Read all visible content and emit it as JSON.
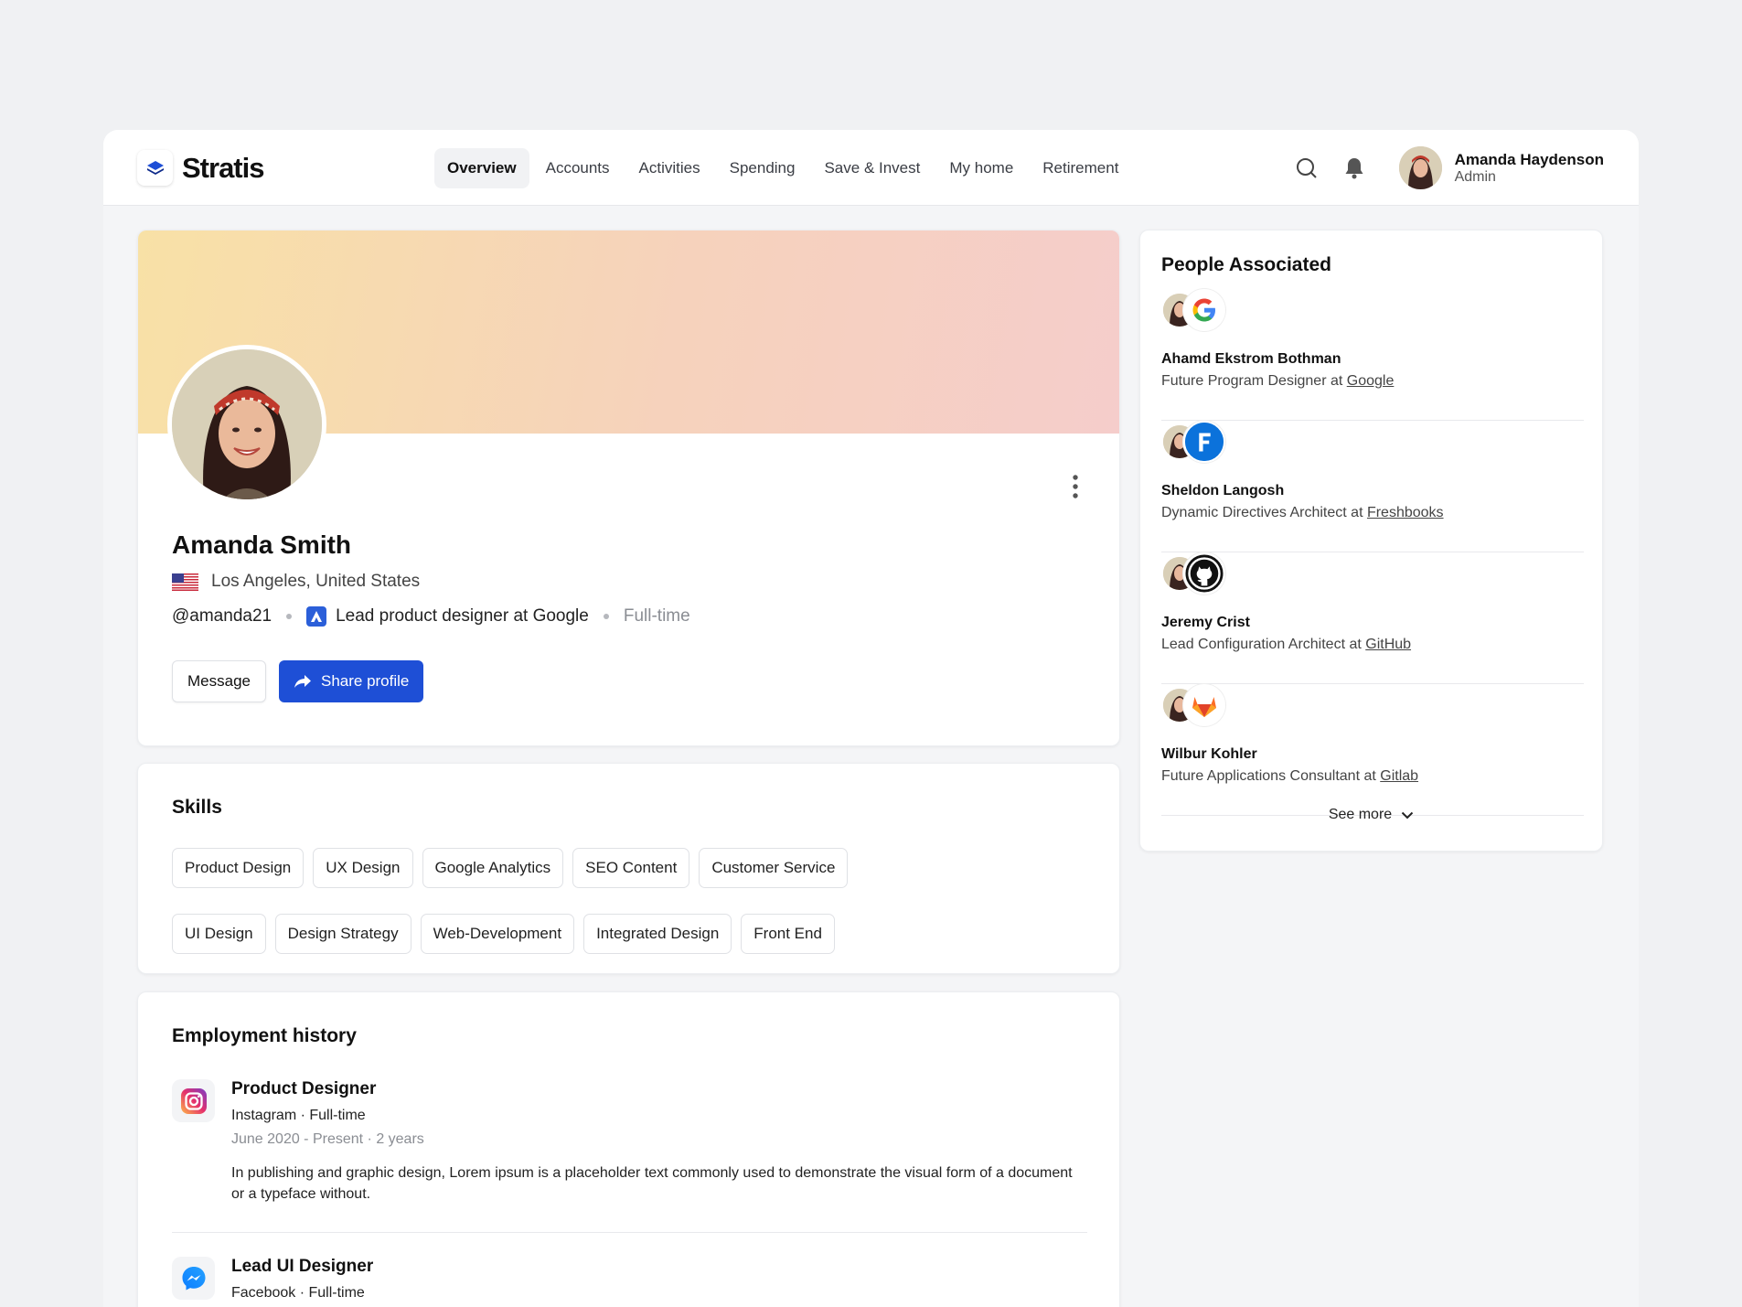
{
  "app": {
    "name": "Stratis"
  },
  "nav": [
    {
      "label": "Overview",
      "active": true
    },
    {
      "label": "Accounts"
    },
    {
      "label": "Activities"
    },
    {
      "label": "Spending"
    },
    {
      "label": "Save & Invest"
    },
    {
      "label": "My home"
    },
    {
      "label": "Retirement"
    }
  ],
  "icons": {
    "search": "search-icon",
    "notifications": "bell-icon"
  },
  "user": {
    "name": "Amanda Haydenson",
    "role": "Admin"
  },
  "profile": {
    "name": "Amanda Smith",
    "location": "Los Angeles, United States",
    "handle": "@amanda21",
    "job": "Lead product designer at Google",
    "employment_type": "Full-time",
    "message_label": "Message",
    "share_label": "Share profile"
  },
  "skills": {
    "title": "Skills",
    "items": [
      "Product Design",
      "UX Design",
      "Google Analytics",
      "SEO Content",
      "Customer Service",
      "UI Design",
      "Design Strategy",
      "Web-Development",
      "Integrated Design",
      "Front End"
    ]
  },
  "employment": {
    "title": "Employment history",
    "jobs": [
      {
        "title": "Product Designer",
        "company": "Instagram · Full-time",
        "dates": "June 2020 - Present · 2 years",
        "description": "In publishing and graphic design, Lorem ipsum is a placeholder text commonly used to demonstrate the visual form of a document or a typeface without."
      },
      {
        "title": "Lead UI Designer",
        "company": "Facebook · Full-time"
      }
    ]
  },
  "people": {
    "title": "People Associated",
    "items": [
      {
        "name": "Ahamd Ekstrom Bothman",
        "role": "Future Program Designer at ",
        "company": "Google"
      },
      {
        "name": "Sheldon Langosh",
        "role": "Dynamic Directives Architect at ",
        "company": "Freshbooks"
      },
      {
        "name": "Jeremy Crist",
        "role": "Lead Configuration Architect at ",
        "company": "GitHub"
      },
      {
        "name": "Wilbur Kohler",
        "role": "Future Applications Consultant at ",
        "company": "Gitlab"
      }
    ],
    "see_more": "See more"
  },
  "colors": {
    "primary": "#1e4fd6",
    "banner_start": "#f8e1a6",
    "banner_end": "#f5cdcb"
  }
}
